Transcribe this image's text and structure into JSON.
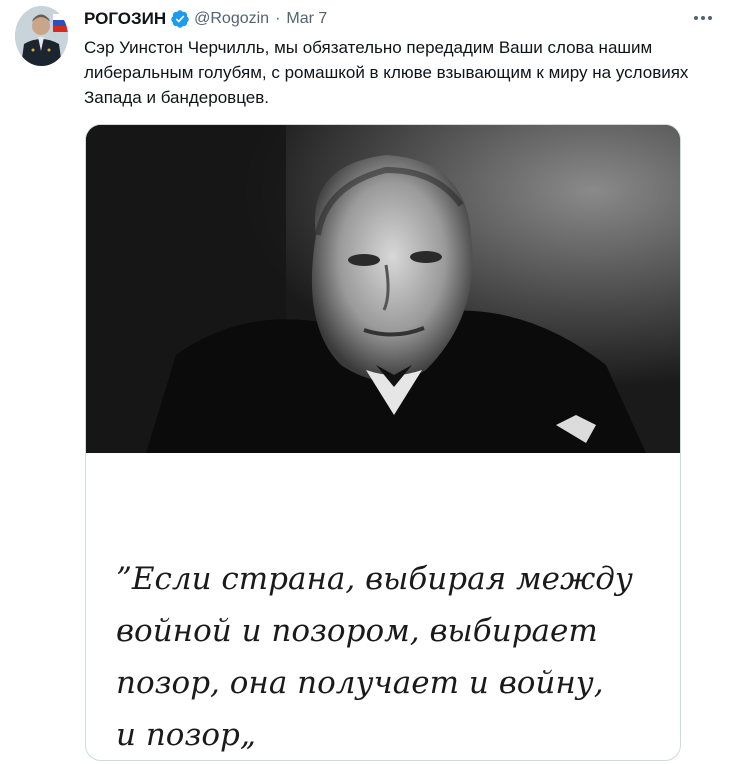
{
  "author": {
    "name": "РОГОЗИН",
    "handle": "@Rogozin",
    "separator": "·",
    "date": "Mar 7",
    "verified_icon": "verified-badge-icon"
  },
  "tweet": {
    "text": "Сэр Уинстон Черчилль, мы обязательно передадим Ваши слова нашим либеральным голубям, с ромашкой в клюве взывающим к миру на условиях Запада и бандеровцев."
  },
  "media": {
    "quote_lines": [
      "”Если страна, выбирая между",
      "войной и позором, выбирает",
      "позор, она получает и войну,",
      "и позор„"
    ]
  },
  "colors": {
    "text": "#0f1419",
    "secondary": "#536471",
    "verified": "#1d9bf0",
    "border": "#cfd9de"
  }
}
